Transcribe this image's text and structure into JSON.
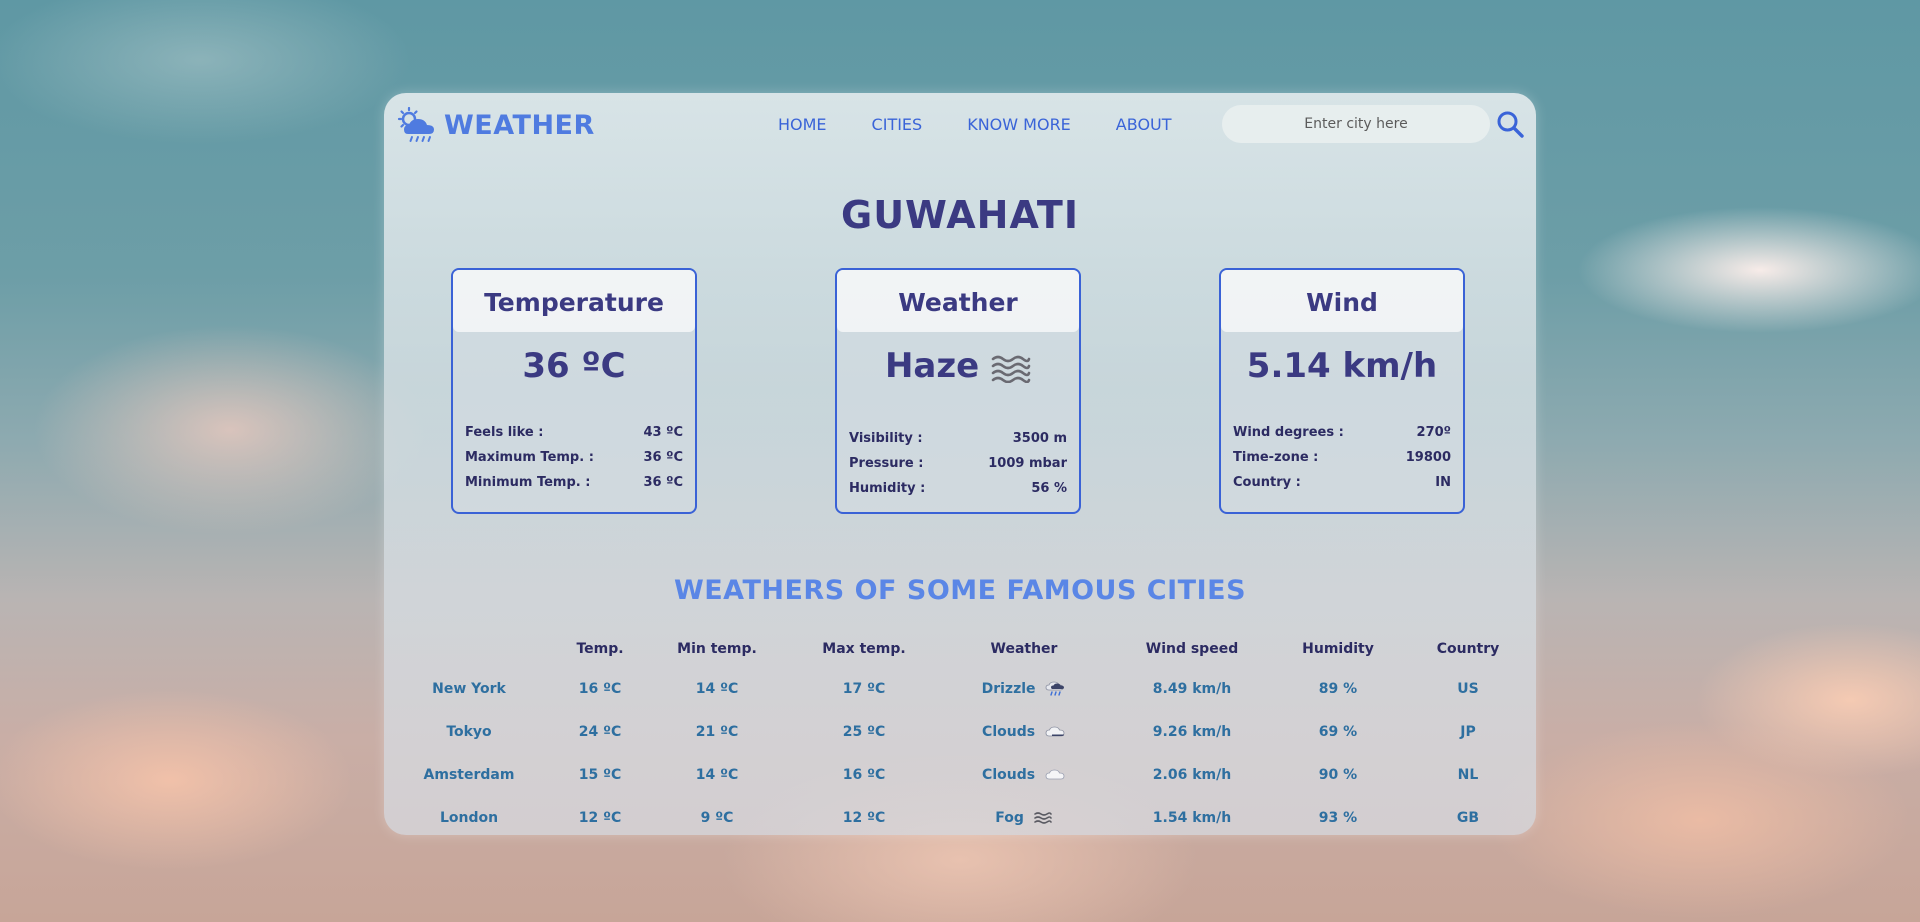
{
  "brand": {
    "name": "WEATHER",
    "logo_icon": "cloud-sun-rain-icon"
  },
  "nav": {
    "items": [
      {
        "label": "HOME"
      },
      {
        "label": "CITIES"
      },
      {
        "label": "KNOW MORE"
      },
      {
        "label": "ABOUT"
      }
    ]
  },
  "search": {
    "placeholder": "Enter city here",
    "button_icon": "search-icon"
  },
  "city": {
    "name": "GUWAHATI"
  },
  "cards": {
    "temperature": {
      "title": "Temperature",
      "main": "36 ºC",
      "rows": [
        {
          "label": "Feels like :",
          "value": "43 ºC"
        },
        {
          "label": "Maximum Temp. :",
          "value": "36 ºC"
        },
        {
          "label": "Minimum Temp. :",
          "value": "36 ºC"
        }
      ]
    },
    "weather": {
      "title": "Weather",
      "main": "Haze",
      "icon": "haze-icon",
      "rows": [
        {
          "label": "Visibility :",
          "value": "3500 m"
        },
        {
          "label": "Pressure :",
          "value": "1009 mbar"
        },
        {
          "label": "Humidity :",
          "value": "56 %"
        }
      ]
    },
    "wind": {
      "title": "Wind",
      "main": "5.14 km/h",
      "rows": [
        {
          "label": "Wind degrees :",
          "value": "270º"
        },
        {
          "label": "Time-zone :",
          "value": "19800"
        },
        {
          "label": "Country :",
          "value": "IN"
        }
      ]
    }
  },
  "famous": {
    "title": "WEATHERS OF SOME FAMOUS CITIES",
    "headers": [
      "",
      "Temp.",
      "Min temp.",
      "Max temp.",
      "Weather",
      "Wind speed",
      "Humidity",
      "Country"
    ],
    "rows": [
      {
        "city": "New York",
        "temp": "16 ºC",
        "min": "14 ºC",
        "max": "17 ºC",
        "weather": "Drizzle",
        "icon": "drizzle-cloud-icon",
        "wind": "8.49 km/h",
        "humidity": "89 %",
        "country": "US"
      },
      {
        "city": "Tokyo",
        "temp": "24 ºC",
        "min": "21 ºC",
        "max": "25 ºC",
        "weather": "Clouds",
        "icon": "cloud-icon",
        "wind": "9.26 km/h",
        "humidity": "69 %",
        "country": "JP"
      },
      {
        "city": "Amsterdam",
        "temp": "15 ºC",
        "min": "14 ºC",
        "max": "16 ºC",
        "weather": "Clouds",
        "icon": "cloud-icon",
        "wind": "2.06 km/h",
        "humidity": "90 %",
        "country": "NL"
      },
      {
        "city": "London",
        "temp": "12 ºC",
        "min": "9 ºC",
        "max": "12 ºC",
        "weather": "Fog",
        "icon": "fog-icon",
        "wind": "1.54 km/h",
        "humidity": "93 %",
        "country": "GB"
      }
    ]
  }
}
